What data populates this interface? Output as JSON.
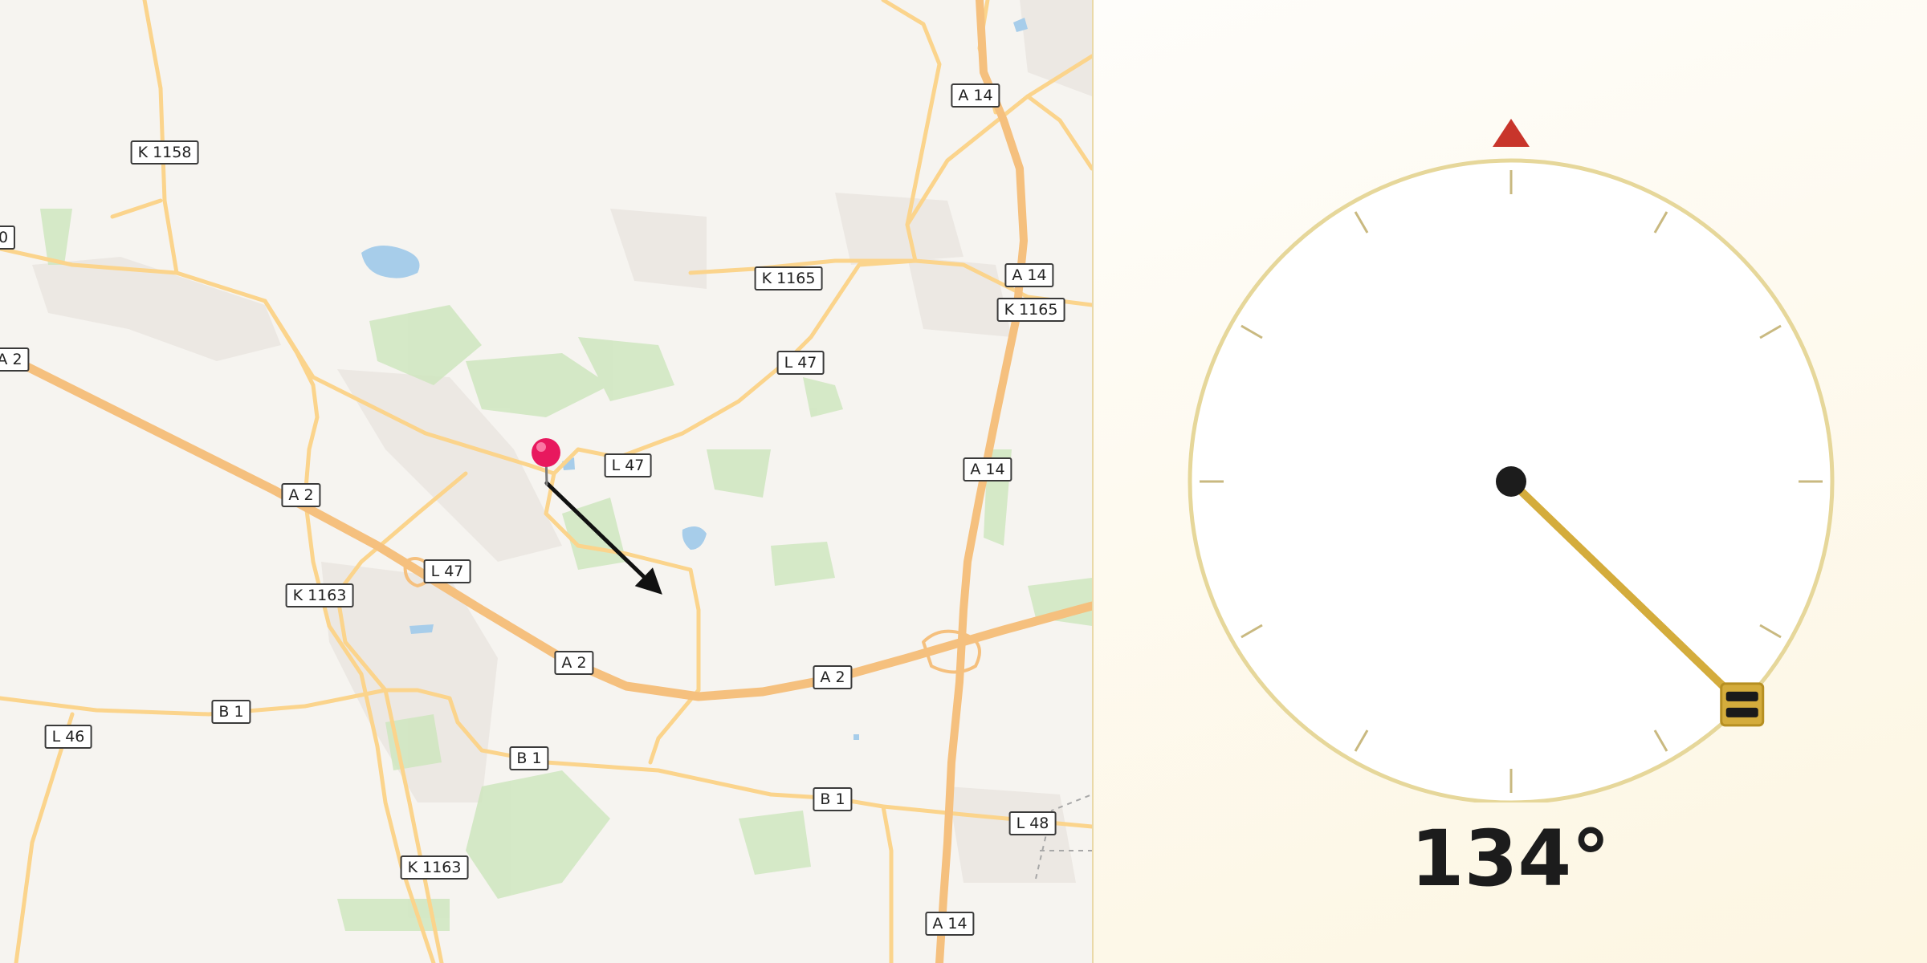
{
  "map": {
    "road_labels": [
      {
        "id": "k1158",
        "text": "K 1158"
      },
      {
        "id": "partial-0",
        "text": "0"
      },
      {
        "id": "a2-left",
        "text": "A 2"
      },
      {
        "id": "a2-west",
        "text": "A 2"
      },
      {
        "id": "a2-center",
        "text": "A 2"
      },
      {
        "id": "a2-east",
        "text": "A 2"
      },
      {
        "id": "a14-top",
        "text": "A 14"
      },
      {
        "id": "a14-upper",
        "text": "A 14"
      },
      {
        "id": "a14-middle",
        "text": "A 14"
      },
      {
        "id": "a14-bottom",
        "text": "A 14"
      },
      {
        "id": "k1165-a",
        "text": "K 1165"
      },
      {
        "id": "k1165-b",
        "text": "K 1165"
      },
      {
        "id": "l47-north",
        "text": "L 47"
      },
      {
        "id": "l47-center",
        "text": "L 47"
      },
      {
        "id": "l47-west",
        "text": "L 47"
      },
      {
        "id": "k1163-a",
        "text": "K 1163"
      },
      {
        "id": "k1163-b",
        "text": "K 1163"
      },
      {
        "id": "b1-west",
        "text": "B 1"
      },
      {
        "id": "b1-center",
        "text": "B 1"
      },
      {
        "id": "b1-east",
        "text": "B 1"
      },
      {
        "id": "l46",
        "text": "L 46"
      },
      {
        "id": "l48",
        "text": "L 48"
      }
    ],
    "pin_color": "#e8185e",
    "direction_arrow_color": "#111111"
  },
  "compass": {
    "heading_degrees": 134,
    "heading_text": "134°",
    "north_marker_color": "#c8352b",
    "ring_color": "#e6d79a",
    "needle_color": "#d4ac3c",
    "hub_color": "#1c1c1c"
  }
}
